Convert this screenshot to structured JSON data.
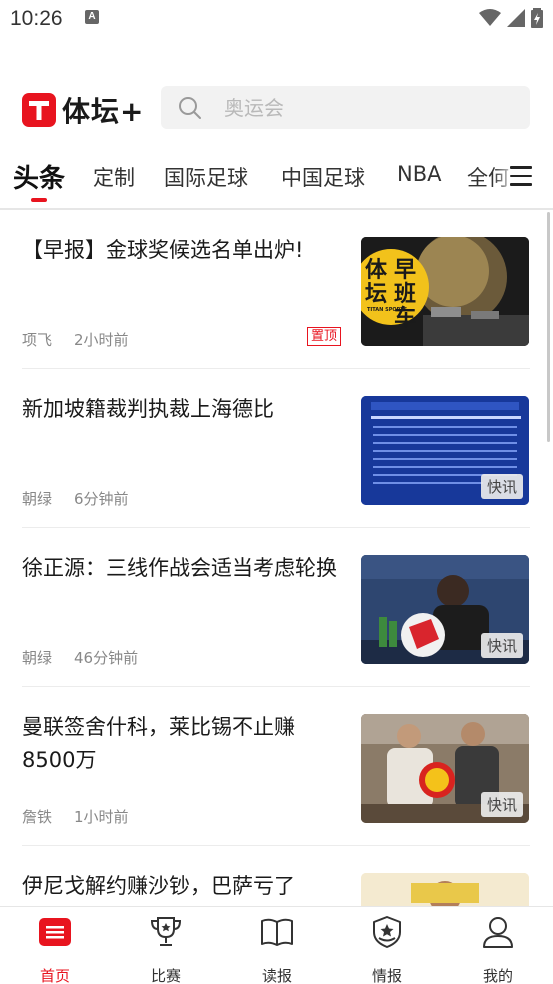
{
  "status_bar": {
    "time": "10:26",
    "notification": "A"
  },
  "header": {
    "logo_text": "体坛+",
    "search_placeholder": "奥运会"
  },
  "tabs": [
    {
      "label": "头条",
      "active": true
    },
    {
      "label": "定制"
    },
    {
      "label": "国际足球"
    },
    {
      "label": "中国足球"
    },
    {
      "label": "NBA"
    },
    {
      "label": "全何"
    }
  ],
  "feed": [
    {
      "title": "【早报】金球奖候选名单出炉!",
      "author": "项飞",
      "time": "2小时前",
      "badge": "置顶",
      "thumb_text": [
        "体",
        "早",
        "坛",
        "班",
        "车"
      ],
      "thumb_sub": "TITAN SPORTS"
    },
    {
      "title": "新加坡籍裁判执裁上海德比",
      "author": "朝绿",
      "time": "6分钟前",
      "thumb_badge": "快讯"
    },
    {
      "title": "徐正源：三线作战会适当考虑轮换",
      "author": "朝绿",
      "time": "46分钟前",
      "thumb_badge": "快讯"
    },
    {
      "title": "曼联签舍什科，莱比锡不止赚8500万",
      "author": "詹铁",
      "time": "1小时前",
      "thumb_badge": "快讯"
    },
    {
      "title": "伊尼戈解约赚沙钞，巴萨亏了"
    }
  ],
  "bottom_nav": [
    {
      "label": "首页",
      "icon": "home-icon",
      "active": true
    },
    {
      "label": "比赛",
      "icon": "trophy-icon"
    },
    {
      "label": "读报",
      "icon": "book-icon"
    },
    {
      "label": "情报",
      "icon": "intel-badge-icon"
    },
    {
      "label": "我的",
      "icon": "profile-icon"
    }
  ],
  "colors": {
    "brand": "#e8141f",
    "text": "#1a1a1a",
    "meta": "#888888"
  }
}
